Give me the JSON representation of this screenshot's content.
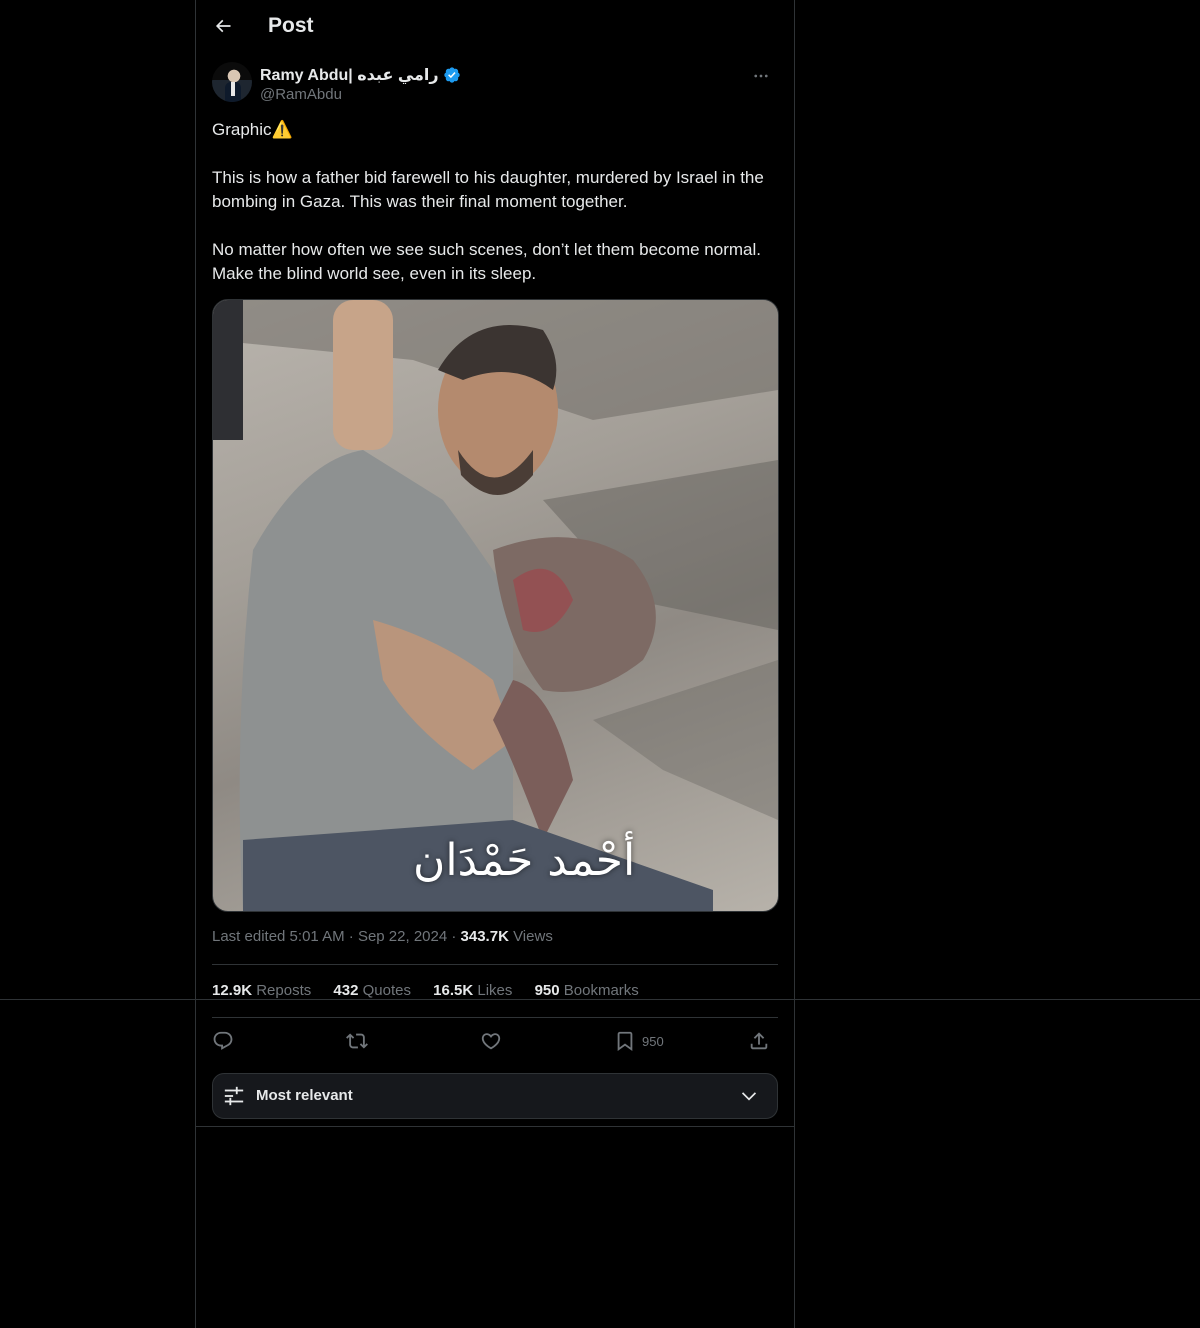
{
  "header": {
    "title": "Post",
    "back_icon": "arrow-left-icon"
  },
  "author": {
    "display_name": "Ramy Abdu| رامي عبده",
    "handle": "@RamAbdu",
    "verified": true,
    "verified_color": "#1d9bf0"
  },
  "tweet": {
    "paragraphs": [
      "Graphic⚠️",
      "This is how a father bid farewell to his daughter, murdered by Israel in the bombing in Gaza. This was their final moment together.",
      "No matter how often we see such scenes, don’t let them become normal. Make the blind world see, even in its sleep."
    ],
    "media_overlay_text": "أحْمد حَمْدَان"
  },
  "meta": {
    "edited": "Last edited 5:01 AM",
    "separator": "·",
    "date": "Sep 22, 2024",
    "views_count": "343.7K",
    "views_label": "Views"
  },
  "stats": {
    "reposts_count": "12.9K",
    "reposts_label": "Reposts",
    "quotes_count": "432",
    "quotes_label": "Quotes",
    "likes_count": "16.5K",
    "likes_label": "Likes",
    "bookmarks_count": "950",
    "bookmarks_label": "Bookmarks"
  },
  "actions": {
    "bookmark_count": "950"
  },
  "sort": {
    "label": "Most relevant"
  },
  "colors": {
    "background": "#000000",
    "text": "#e7e9ea",
    "muted": "#71767b",
    "border": "#2f3336"
  }
}
